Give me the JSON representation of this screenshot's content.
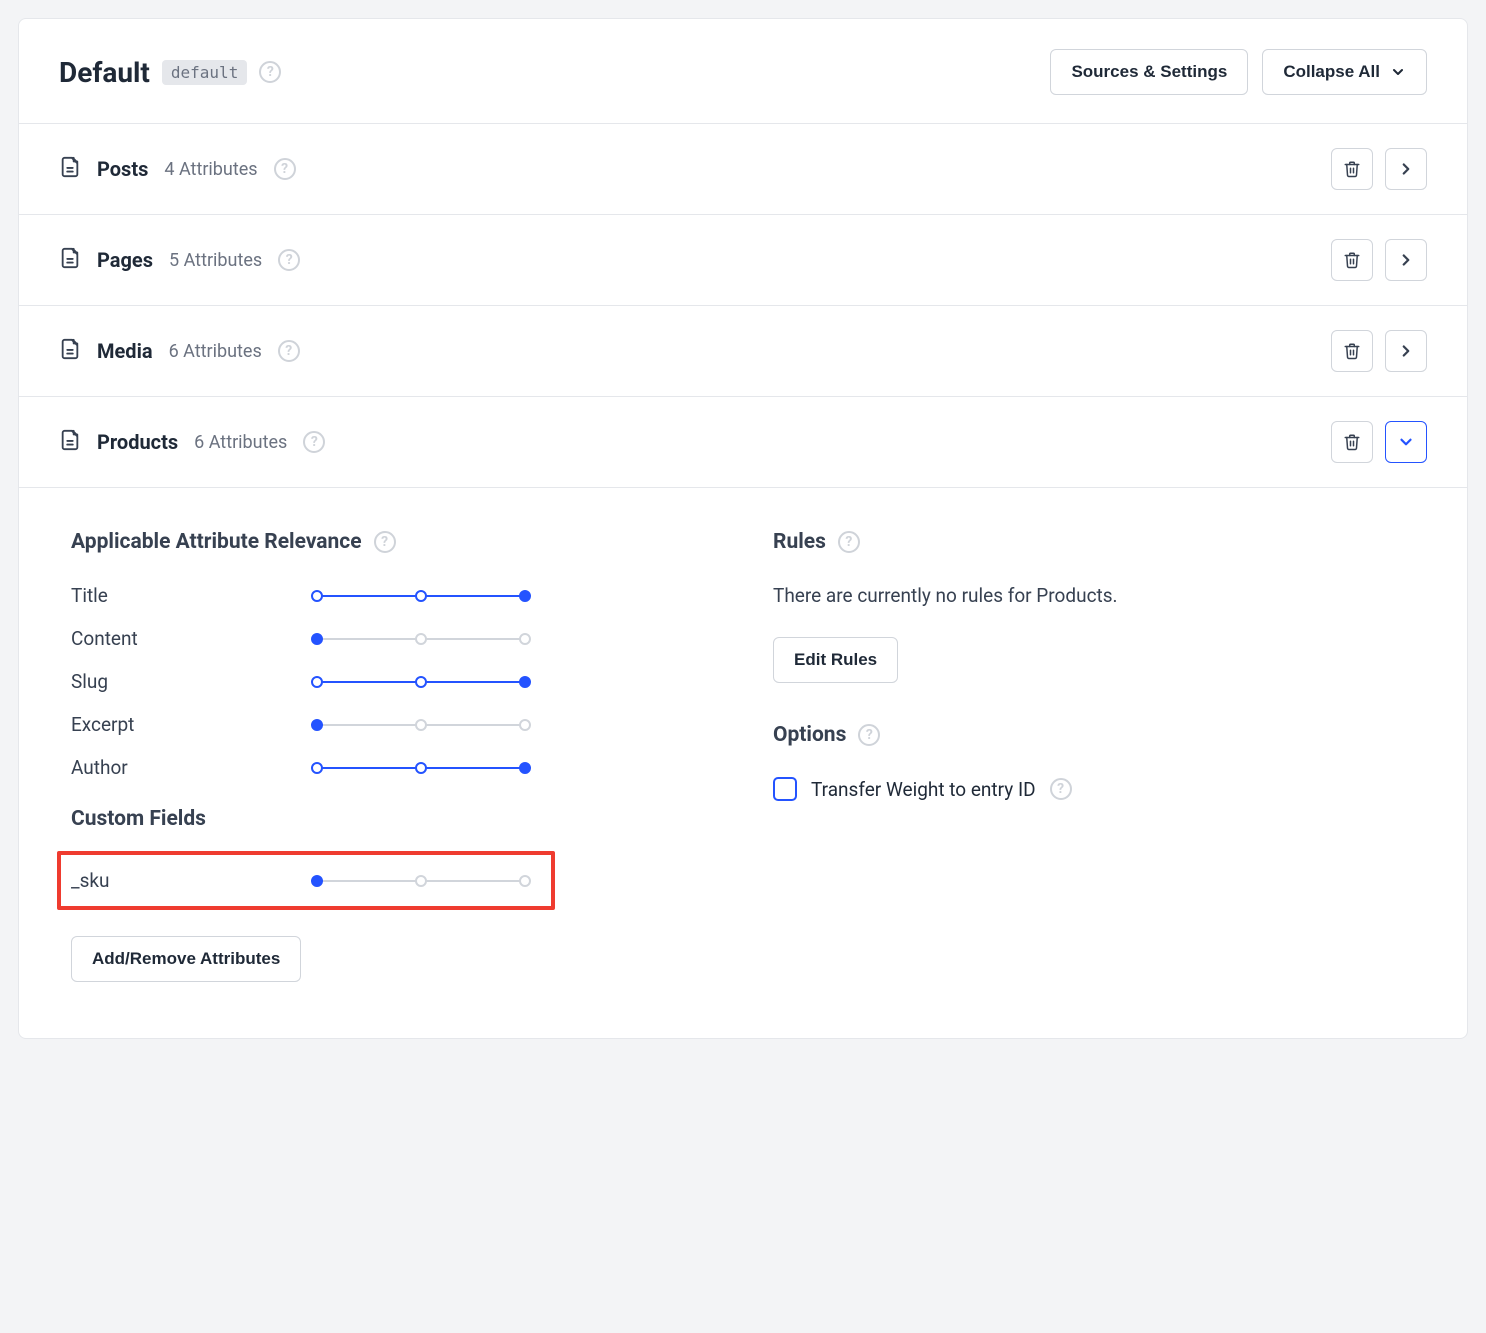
{
  "header": {
    "title": "Default",
    "badge": "default",
    "sources_btn": "Sources & Settings",
    "collapse_btn": "Collapse All"
  },
  "rows": [
    {
      "id": "posts",
      "title": "Posts",
      "count": 4,
      "suffix": "Attributes",
      "expanded": false
    },
    {
      "id": "pages",
      "title": "Pages",
      "count": 5,
      "suffix": "Attributes",
      "expanded": false
    },
    {
      "id": "media",
      "title": "Media",
      "count": 6,
      "suffix": "Attributes",
      "expanded": false
    },
    {
      "id": "products",
      "title": "Products",
      "count": 6,
      "suffix": "Attributes",
      "expanded": true
    }
  ],
  "panel": {
    "relevance_heading": "Applicable Attribute Relevance",
    "attributes": [
      {
        "label": "Title",
        "value": 2
      },
      {
        "label": "Content",
        "value": 0
      },
      {
        "label": "Slug",
        "value": 2
      },
      {
        "label": "Excerpt",
        "value": 0
      },
      {
        "label": "Author",
        "value": 2
      }
    ],
    "custom_heading": "Custom Fields",
    "custom_fields": [
      {
        "label": "_sku",
        "value": 0
      }
    ],
    "add_remove_btn": "Add/Remove Attributes",
    "rules_heading": "Rules",
    "rules_empty": "There are currently no rules for Products.",
    "edit_rules_btn": "Edit Rules",
    "options_heading": "Options",
    "option_transfer": "Transfer Weight to entry ID"
  }
}
